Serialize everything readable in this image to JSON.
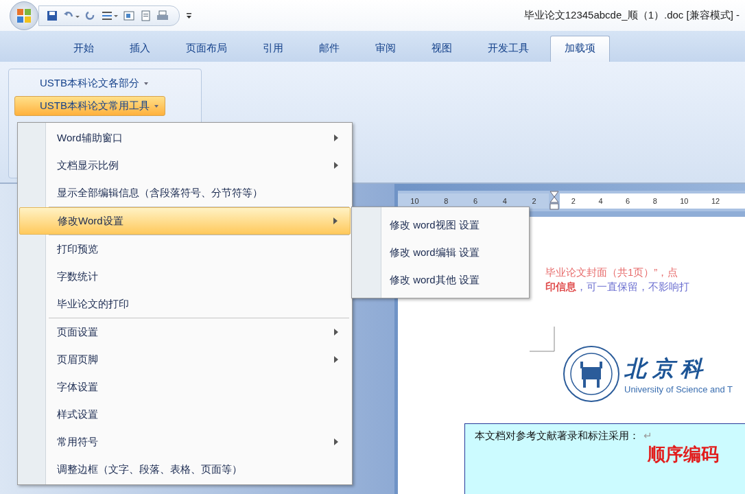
{
  "window": {
    "title": "毕业论文12345abcde_顺（1）.doc [兼容模式] -"
  },
  "tabs": [
    {
      "label": "开始",
      "selected": false
    },
    {
      "label": "插入",
      "selected": false
    },
    {
      "label": "页面布局",
      "selected": false
    },
    {
      "label": "引用",
      "selected": false
    },
    {
      "label": "邮件",
      "selected": false
    },
    {
      "label": "审阅",
      "selected": false
    },
    {
      "label": "视图",
      "selected": false
    },
    {
      "label": "开发工具",
      "selected": false
    },
    {
      "label": "加载项",
      "selected": true
    }
  ],
  "ribbon": {
    "buttons": [
      {
        "label": "USTB本科论文各部分",
        "selected": false
      },
      {
        "label": "USTB本科论文常用工具",
        "selected": true
      }
    ]
  },
  "menu": {
    "groups": [
      [
        {
          "label": "Word辅助窗口",
          "submenu": true,
          "selected": false
        },
        {
          "label": "文档显示比例",
          "submenu": true,
          "selected": false
        },
        {
          "label": "显示全部编辑信息（含段落符号、分节符等）",
          "submenu": false,
          "selected": false
        }
      ],
      [
        {
          "label": "修改Word设置",
          "submenu": true,
          "selected": true
        }
      ],
      [
        {
          "label": "打印预览",
          "submenu": false,
          "selected": false
        },
        {
          "label": "字数统计",
          "submenu": false,
          "selected": false
        },
        {
          "label": "毕业论文的打印",
          "submenu": false,
          "selected": false
        }
      ],
      [
        {
          "label": "页面设置",
          "submenu": true,
          "selected": false
        },
        {
          "label": "页眉页脚",
          "submenu": true,
          "selected": false
        },
        {
          "label": "字体设置",
          "submenu": false,
          "selected": false
        },
        {
          "label": "样式设置",
          "submenu": false,
          "selected": false
        },
        {
          "label": "常用符号",
          "submenu": true,
          "selected": false
        },
        {
          "label": "调整边框（文字、段落、表格、页面等）",
          "submenu": false,
          "selected": false
        }
      ]
    ]
  },
  "submenu": {
    "items": [
      "修改 word视图 设置",
      "修改 word编辑 设置",
      "修改 word其他 设置"
    ]
  },
  "ruler": {
    "left_ticks": [
      "10",
      "8",
      "6",
      "4",
      "2"
    ],
    "right_ticks": [
      "2",
      "4",
      "6",
      "8",
      "10",
      "12"
    ]
  },
  "document": {
    "notes": [
      [
        {
          "text": "毕业论文封面（共1页）”，点",
          "kind": "red"
        }
      ],
      [
        {
          "text": "印信息",
          "kind": "red-bold"
        },
        {
          "text": "，可一直保留，不影响打",
          "kind": "blue"
        }
      ]
    ],
    "logo_title": "北 京 科",
    "logo_subtitle": "University of Science and T",
    "box_text": "本文档对参考文献著录和标注采用：",
    "box_mark": "↵",
    "box_heading": "顺序编码"
  }
}
